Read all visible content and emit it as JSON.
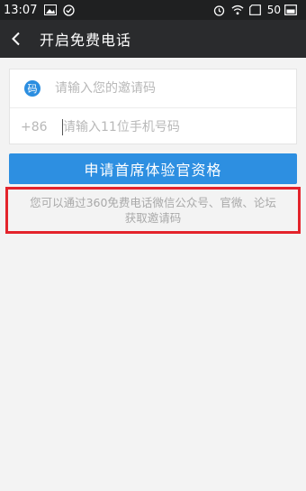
{
  "status_bar": {
    "time": "13:07",
    "battery_level": "50",
    "icons": [
      "gallery-icon",
      "check-circle-icon",
      "alarm-icon",
      "wifi-icon",
      "sim-icon",
      "battery-icon"
    ]
  },
  "header": {
    "title": "开启免费电话"
  },
  "form": {
    "invite_badge": "码",
    "invite_placeholder": "请输入您的邀请码",
    "phone_prefix": "+86",
    "phone_placeholder": "请输入11位手机号码"
  },
  "apply_button": {
    "label": "申请首席体验官资格",
    "color": "#2d8fe1"
  },
  "hint": {
    "line1": "您可以通过360免费电话微信公众号、官微、论坛",
    "line2": "获取邀请码",
    "highlight_color": "#e3232b"
  }
}
